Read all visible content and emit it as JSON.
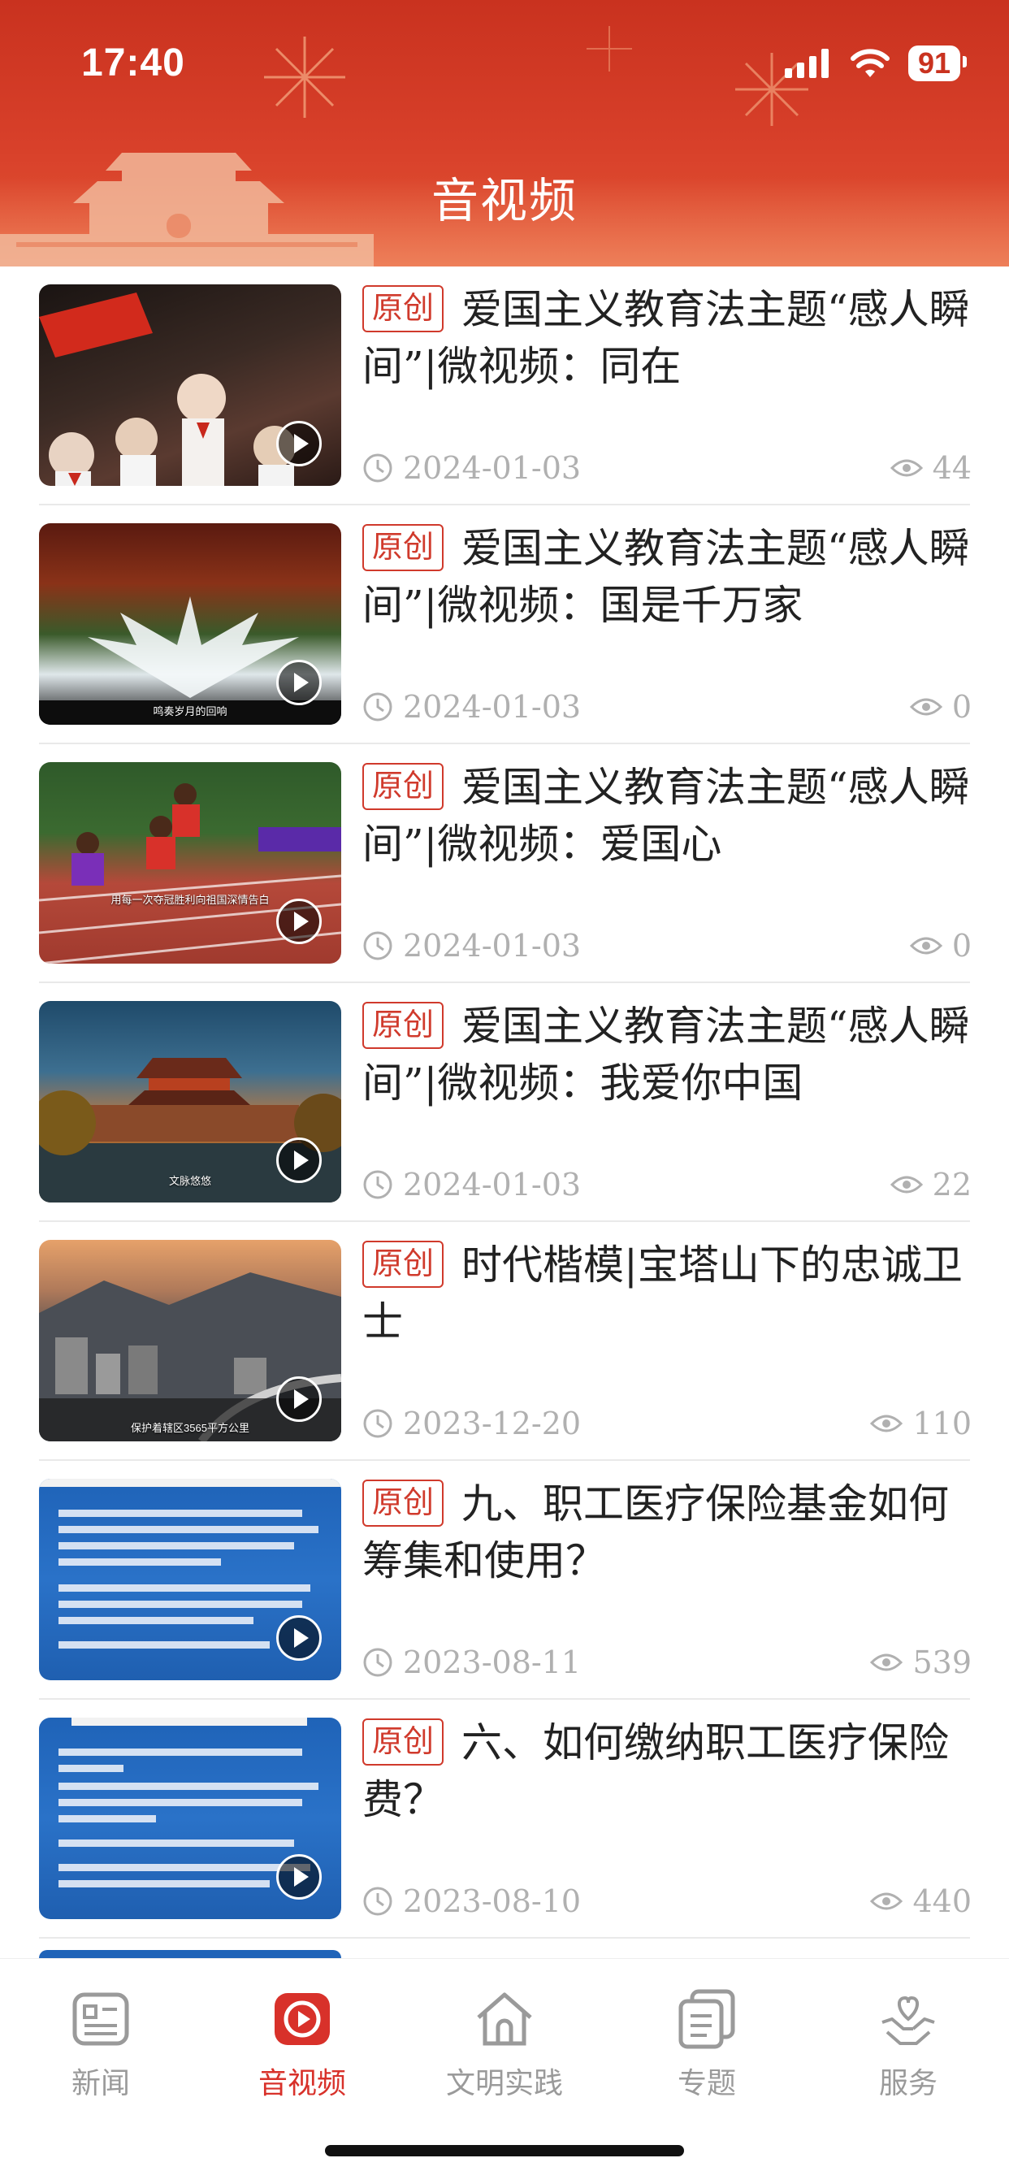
{
  "status_bar": {
    "time": "17:40",
    "battery": "91"
  },
  "header": {
    "title": "音视频"
  },
  "colors": {
    "brand_red": "#d03a2c",
    "header_red": "#c9321f",
    "meta_gray": "#b0b0b0"
  },
  "items": [
    {
      "tag": "原创",
      "title": "爱国主义教育法主题“感人瞬间”|微视频：同在",
      "date": "2024-01-03",
      "views": "44",
      "thumb_caption": ""
    },
    {
      "tag": "原创",
      "title": "爱国主义教育法主题“感人瞬间”|微视频：国是千万家",
      "date": "2024-01-03",
      "views": "0",
      "thumb_caption": "鸣奏岁月的回响"
    },
    {
      "tag": "原创",
      "title": "爱国主义教育法主题“感人瞬间”|微视频：爱国心",
      "date": "2024-01-03",
      "views": "0",
      "thumb_caption": "用每一次夺冠胜利向祖国深情告白"
    },
    {
      "tag": "原创",
      "title": "爱国主义教育法主题“感人瞬间”|微视频：我爱你中国",
      "date": "2024-01-03",
      "views": "22",
      "thumb_caption": "文脉悠悠"
    },
    {
      "tag": "原创",
      "title": "时代楷模|宝塔山下的忠诚卫士",
      "date": "2023-12-20",
      "views": "110",
      "thumb_caption": "保护着辖区3565平方公里"
    },
    {
      "tag": "原创",
      "title": "九、职工医疗保险基金如何筹集和使用？",
      "date": "2023-08-11",
      "views": "539",
      "thumb_caption": ""
    },
    {
      "tag": "原创",
      "title": "六、如何缴纳职工医疗保险费？",
      "date": "2023-08-10",
      "views": "440",
      "thumb_caption": ""
    }
  ],
  "nav": [
    {
      "label": "新闻",
      "icon": "news-icon"
    },
    {
      "label": "音视频",
      "icon": "video-icon"
    },
    {
      "label": "文明实践",
      "icon": "home-icon"
    },
    {
      "label": "专题",
      "icon": "topic-icon"
    },
    {
      "label": "服务",
      "icon": "service-icon"
    }
  ]
}
